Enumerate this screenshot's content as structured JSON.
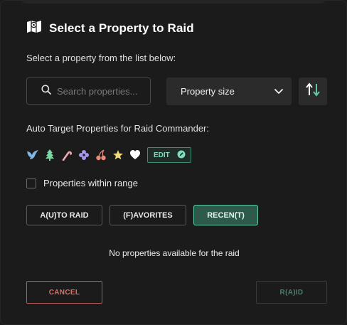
{
  "dialog": {
    "title": "Select a Property to Raid",
    "subtitle": "Select a property from the list below:"
  },
  "search": {
    "placeholder": "Search properties...",
    "value": ""
  },
  "sort": {
    "selected": "Property size"
  },
  "auto_target": {
    "label": "Auto Target Properties for Raid Commander:",
    "icons": [
      "bird-icon",
      "tree-icon",
      "candy-cane-icon",
      "flower-icon",
      "cherries-icon",
      "star-icon",
      "heart-icon"
    ],
    "edit_label": "EDIT"
  },
  "range": {
    "label": "Properties within range",
    "checked": false
  },
  "tabs": [
    {
      "label": "A(U)TO RAID",
      "active": false
    },
    {
      "label": "(F)AVORITES",
      "active": false
    },
    {
      "label": "RECEN(T)",
      "active": true
    }
  ],
  "empty_message": "No properties available for the raid",
  "actions": {
    "cancel": "CANCEL",
    "raid": "R(A)ID"
  },
  "colors": {
    "accent": "#5ec7a4",
    "danger": "#d8716b",
    "background": "#1b1b1b"
  }
}
